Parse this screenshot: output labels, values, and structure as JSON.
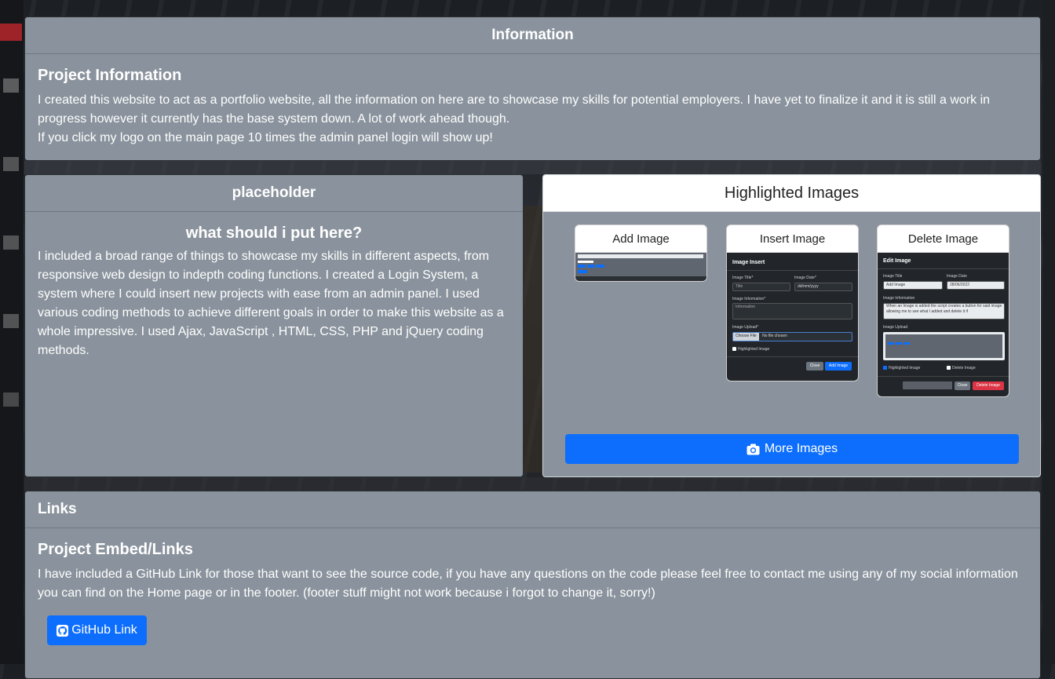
{
  "info": {
    "header": "Information",
    "title": "Project Information",
    "paragraph1": "I created this website to act as a portfolio website, all the information on here are to showcase my skills for potential employers. I have yet to finalize it and it is still a work in progress however it currently has the base system down. A lot of work ahead though.",
    "paragraph2": "If you click my logo on the main page 10 times the admin panel login will show up!"
  },
  "placeholder": {
    "header": "placeholder",
    "title": "what should i put here?",
    "paragraph": "I included a broad range of things to showcase my skills in different aspects, from responsive web design to indepth coding functions. I created a Login System, a system where I could insert new projects with ease from an admin panel. I used various coding methods to achieve different goals in order to make this website as a whole impressive. I used Ajax, JavaScript , HTML, CSS, PHP and jQuery coding methods."
  },
  "highlighted": {
    "header": "Highlighted Images",
    "thumbnails": [
      {
        "title": "Add Image"
      },
      {
        "title": "Insert Image",
        "modal_title": "Image Insert",
        "field_title_label": "Image Title*",
        "field_title_placeholder": "Title",
        "field_date_label": "Image Date*",
        "field_date_value": "dd/mm/yyyy",
        "field_info_label": "Image Information*",
        "field_info_placeholder": "Information",
        "field_upload_label": "Image Upload*",
        "choose_file": "Choose File",
        "no_file": "No file chosen",
        "checkbox_label": "Highlighted Image",
        "close_label": "Close",
        "submit_label": "Add Image"
      },
      {
        "title": "Delete Image",
        "modal_title": "Edit Image",
        "field_title_label": "Image Title",
        "field_title_value": "Add Image",
        "field_date_label": "Image Date",
        "field_date_value": "28/06/2022",
        "field_info_label": "Image Information",
        "field_info_value": "When an Image is added the script creates a button for said image allowing me to see what I added and delete it if",
        "field_upload_label": "Image Upload",
        "checkbox_highlighted": "Highlighted Image",
        "checkbox_delete": "Delete Image",
        "close_label": "Close",
        "delete_label": "Delete Image"
      }
    ],
    "more_button": "More Images",
    "more_icon": "camera-icon",
    "colors": {
      "primary": "#0d6efd",
      "danger": "#dc3545"
    }
  },
  "links": {
    "header": "Links",
    "title": "Project Embed/Links",
    "paragraph": "I have included a GitHub Link for those that want to see the source code, if you have any questions on the code please feel free to contact me using any of my social information you can find on the Home page or in the footer. (footer stuff might not work because i forgot to change it, sorry!)",
    "github_button": "GitHub Link",
    "github_icon": "github-icon"
  }
}
